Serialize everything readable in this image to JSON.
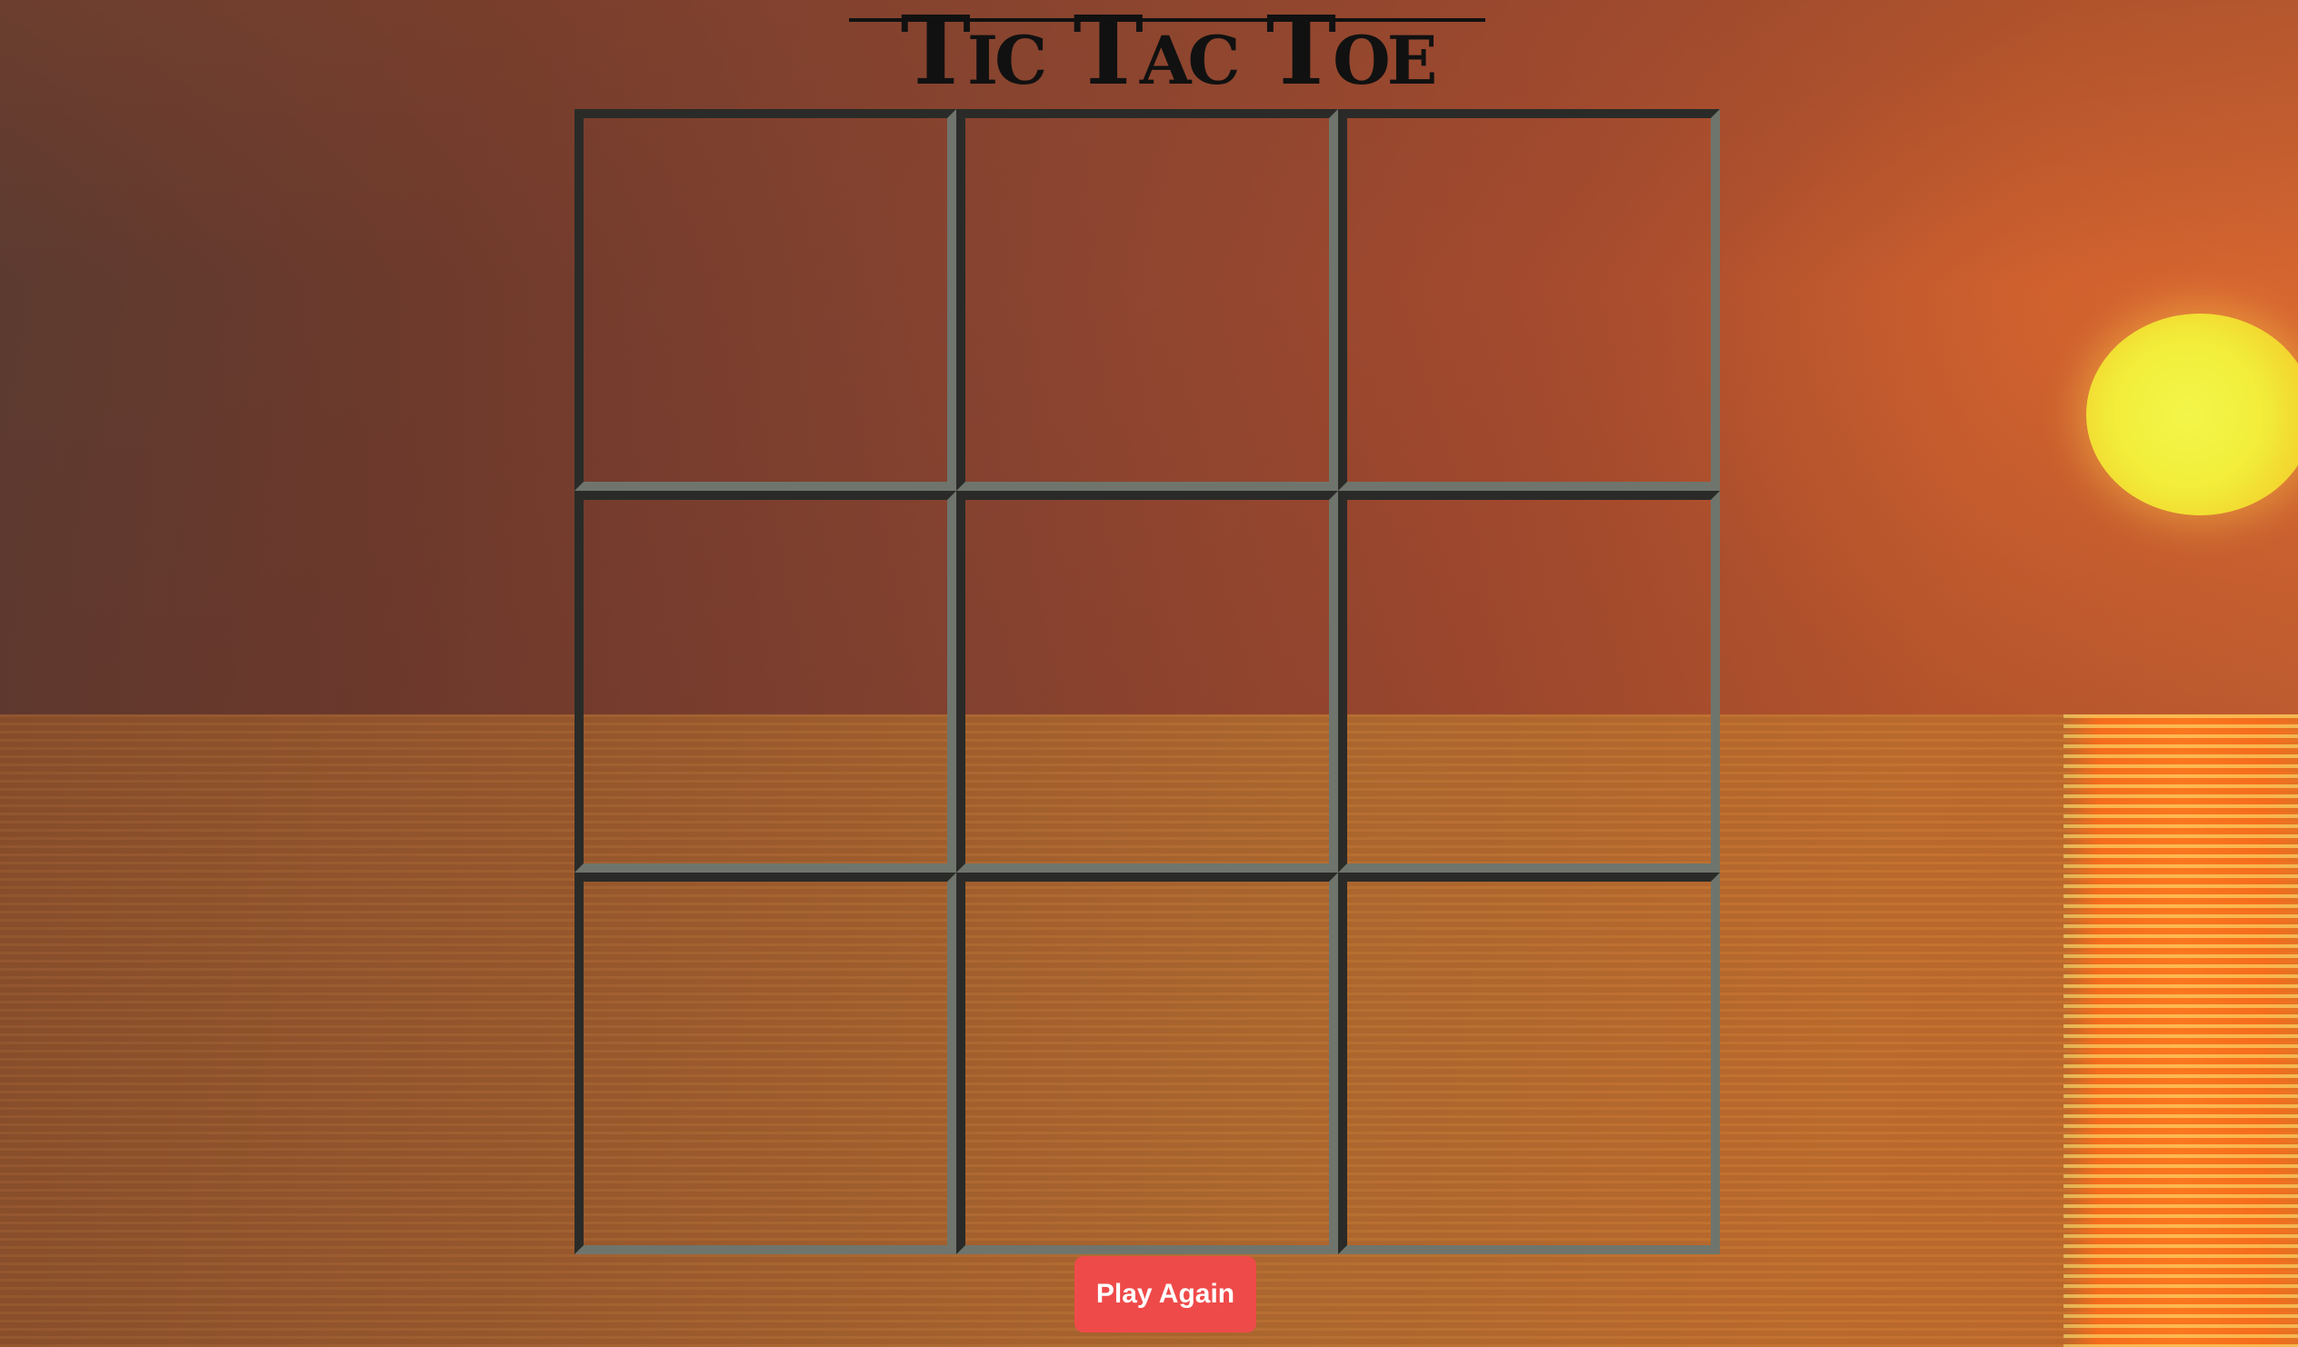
{
  "title": "Tic Tac Toe",
  "board": {
    "cells": [
      "",
      "",
      "",
      "",
      "",
      "",
      "",
      "",
      ""
    ]
  },
  "controls": {
    "play_again_label": "Play Again"
  },
  "colors": {
    "button_bg": "#ef4a4a",
    "button_text": "#ffffff",
    "grid_dark": "#2a2b28",
    "grid_light": "#6f756c",
    "title": "#111111"
  },
  "background": {
    "scene": "sunset-over-sea"
  }
}
